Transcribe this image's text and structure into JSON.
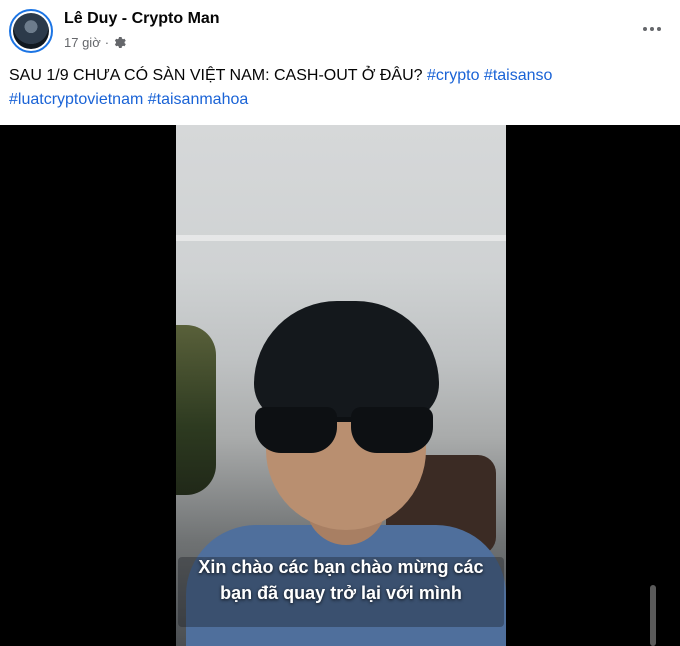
{
  "post": {
    "author": "Lê Duy - Crypto Man",
    "time": "17 giờ",
    "separator": "·",
    "caption_text": "SAU 1/9 CHƯA CÓ SÀN VIỆT NAM: CASH-OUT Ở ĐÂU?",
    "hashtags": [
      "#crypto",
      "#taisanso",
      "#luatcryptovietnam",
      "#taisanmahoa"
    ]
  },
  "video": {
    "subtitle_line1": "Xin chào các bạn chào mừng các",
    "subtitle_line2": "bạn đã quay trở lại với mình"
  },
  "icons": {
    "privacy": "gear-icon",
    "more": "more-options-icon"
  },
  "colors": {
    "hashtag": "#1a63d6",
    "avatar_ring": "#1b74e4",
    "meta_text": "#65676b"
  }
}
